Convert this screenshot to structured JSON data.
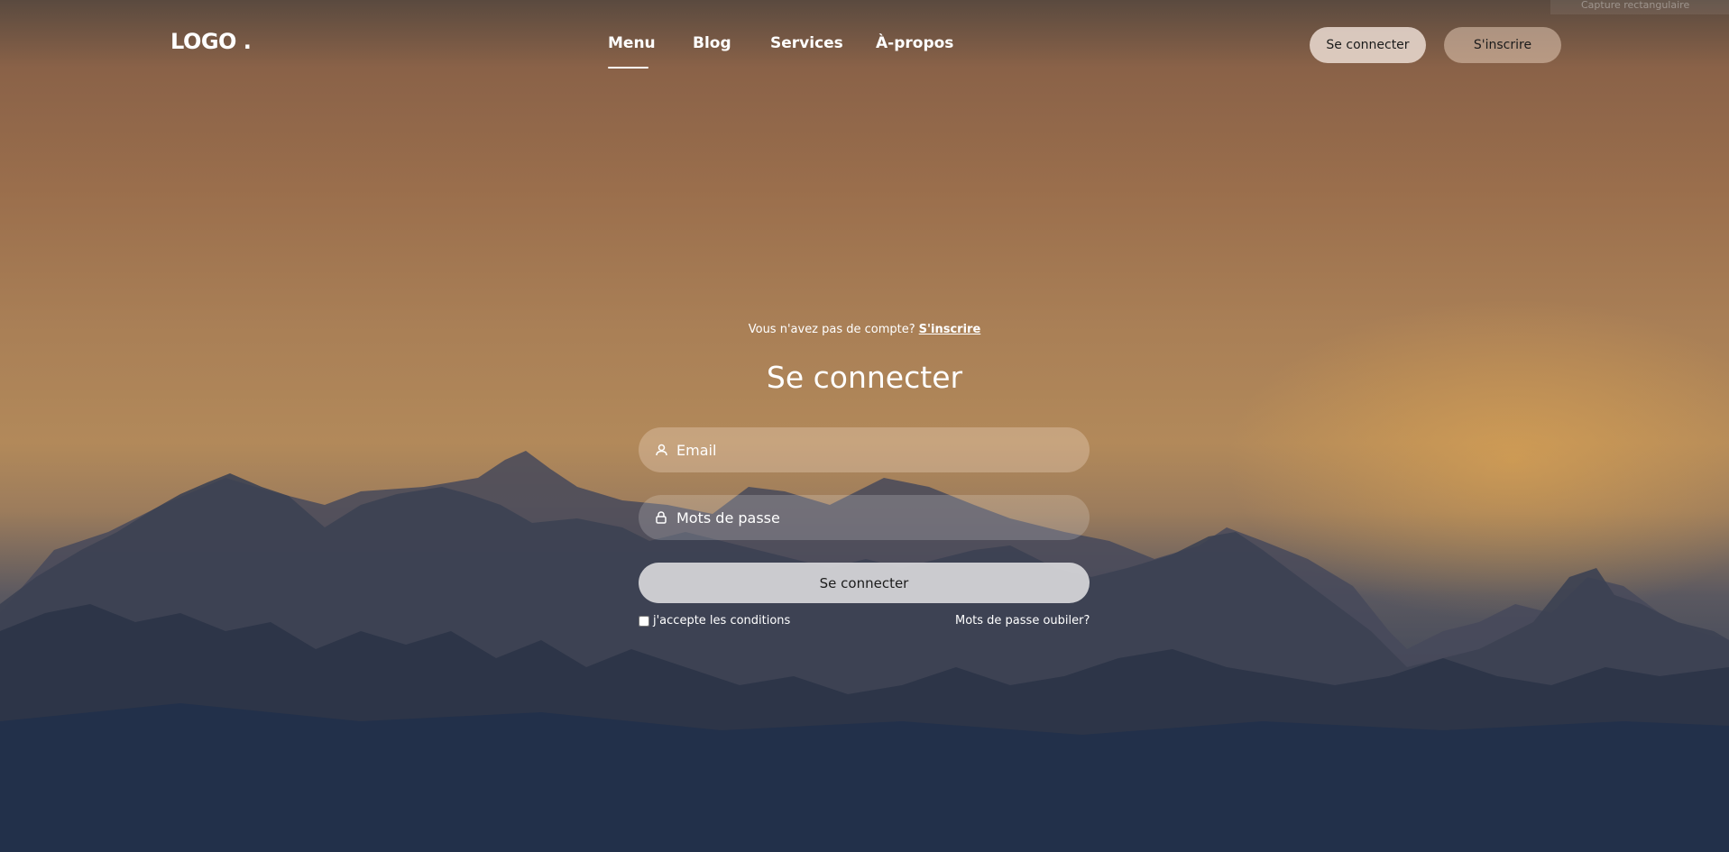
{
  "capture_overlay": {
    "label": "Capture rectangulaire"
  },
  "header": {
    "logo": "LOGO .",
    "nav": [
      {
        "label": "Menu",
        "active": true
      },
      {
        "label": "Blog",
        "active": false
      },
      {
        "label": "Services",
        "active": false
      },
      {
        "label": "À-propos",
        "active": false
      }
    ],
    "login_label": "Se connecter",
    "signup_label": "S'inscrire"
  },
  "form": {
    "prompt_text": "Vous n'avez pas de compte?",
    "prompt_link": "S'inscrire",
    "title": "Se connecter",
    "email": {
      "placeholder": "Email",
      "icon": "user-icon"
    },
    "password": {
      "placeholder": "Mots de passe",
      "icon": "lock-icon"
    },
    "submit_label": "Se connecter",
    "terms_label": "j'accepte les conditions",
    "terms_checked": false,
    "forgot_label": "Mots de passe oubiler?"
  },
  "colors": {
    "sky_top": "#5a4a3f",
    "sky_mid": "#b2895a",
    "mountains": "#3a4457",
    "valley": "#223149"
  }
}
